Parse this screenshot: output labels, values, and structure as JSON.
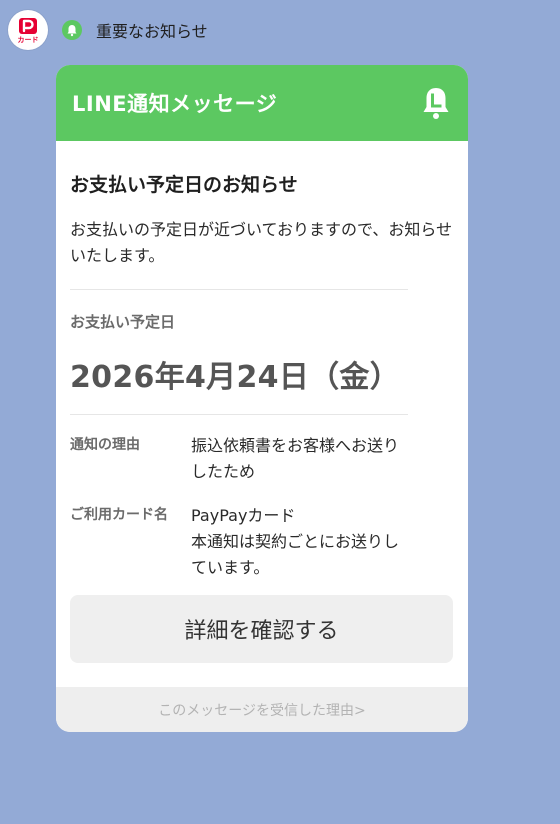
{
  "sender": {
    "avatar_text": "カード",
    "name": "重要なお知らせ",
    "brand_color": "#e60033",
    "icon": "bell-icon"
  },
  "card": {
    "header_title": "LINE通知メッセージ",
    "header_icon": "line-bell-icon",
    "header_color": "#5cc861",
    "notice_title": "お支払い予定日のお知らせ",
    "notice_description": "お支払いの予定日が近づいておりますので、お知らせいたします。",
    "due_label": "お支払い予定日",
    "due_date": "2026年4月24日（金）",
    "info": [
      {
        "label": "通知の理由",
        "value": "振込依頼書をお客様へお送りしたため"
      },
      {
        "label": "ご利用カード名",
        "value": "PayPayカード\n本通知は契約ごとにお送りしています。"
      }
    ],
    "detail_button": "詳細を確認する",
    "footer_link": "このメッセージを受信した理由>"
  }
}
